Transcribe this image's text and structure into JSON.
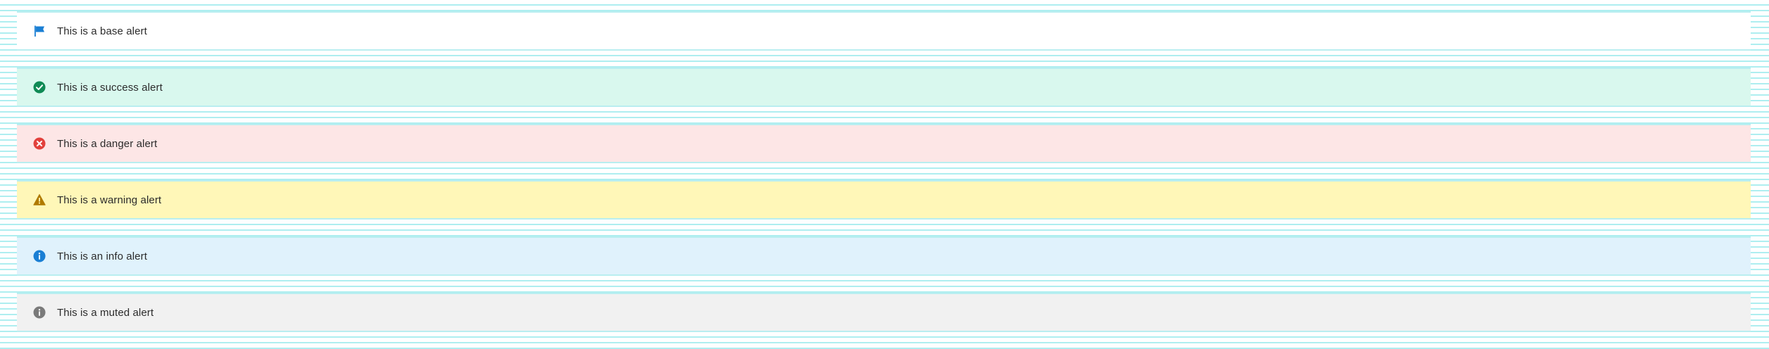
{
  "alerts": [
    {
      "id": "base",
      "text": "This is a base alert",
      "icon": "flag-icon",
      "background": "#ffffff",
      "icon_color": "#1a7fd4"
    },
    {
      "id": "success",
      "text": "This is a success alert",
      "icon": "check-circle-icon",
      "background": "#d9f8ee",
      "icon_color": "#0f8a55"
    },
    {
      "id": "danger",
      "text": "This is a danger alert",
      "icon": "x-circle-icon",
      "background": "#fde6e6",
      "icon_color": "#e2413c"
    },
    {
      "id": "warning",
      "text": "This is a warning alert",
      "icon": "warning-triangle-icon",
      "background": "#fff7b8",
      "icon_color": "#b07a00"
    },
    {
      "id": "info",
      "text": "This is an info alert",
      "icon": "info-circle-icon",
      "background": "#e0f2fc",
      "icon_color": "#1a7fd4"
    },
    {
      "id": "muted",
      "text": "This is a muted alert",
      "icon": "info-circle-icon",
      "background": "#f1f1f1",
      "icon_color": "#7a7a7a"
    }
  ]
}
